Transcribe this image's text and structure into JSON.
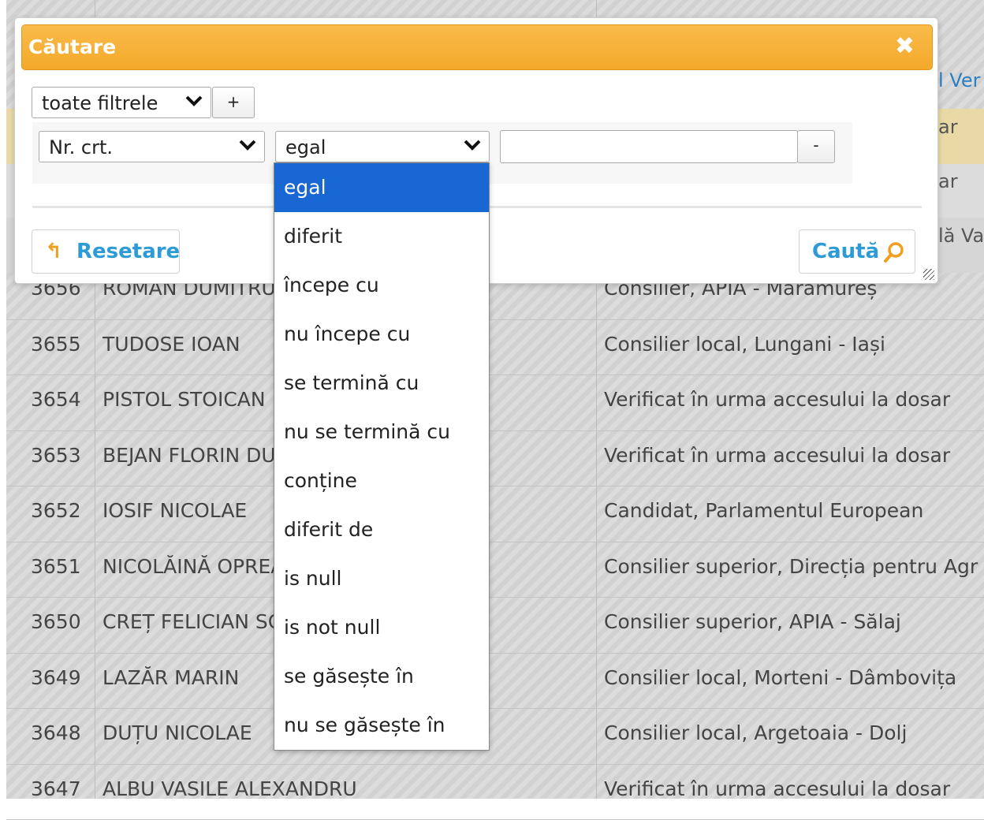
{
  "dialog": {
    "title": "Căutare",
    "close_glyph": "✖",
    "group_filter": {
      "value": "toate filtrele",
      "chevron": "❯"
    },
    "add_button_label": "+",
    "rule": {
      "field_value": "Nr. crt.",
      "operator_value": "egal",
      "value_input": "",
      "remove_button_label": "-"
    },
    "reset_button": {
      "label": "Resetare",
      "icon": "↰"
    },
    "search_button": {
      "label": "Caută",
      "icon": "search-icon"
    }
  },
  "operator_dropdown": {
    "selected": "egal",
    "options": [
      "egal",
      "diferit",
      "începe cu",
      "nu începe cu",
      "se termină cu",
      "nu se termină cu",
      "conține",
      "diferit de",
      "is null",
      "is not null",
      "se găsește în",
      "nu se găsește în"
    ]
  },
  "grid": {
    "peek_texts": [
      "l Ver",
      "ar",
      "ar",
      "lă Va"
    ],
    "rows": [
      {
        "nr": "3656",
        "name": "ROMAN DUMITRU",
        "function": "Consilier, APIA - Maramureș"
      },
      {
        "nr": "3655",
        "name": "TUDOSE IOAN",
        "function": "Consilier local, Lungani - Iași"
      },
      {
        "nr": "3654",
        "name": "PISTOL STOICAN",
        "function": "Verificat în urma accesului la dosar"
      },
      {
        "nr": "3653",
        "name": "BEJAN FLORIN DU",
        "function": "Verificat în urma accesului la dosar"
      },
      {
        "nr": "3652",
        "name": "IOSIF NICOLAE",
        "function": "Candidat, Parlamentul European"
      },
      {
        "nr": "3651",
        "name": "NICOLĂINĂ OPREA",
        "function": "Consilier superior, Direcția pentru Agr"
      },
      {
        "nr": "3650",
        "name": "CREȚ FELICIAN SC",
        "function": "Consilier superior, APIA - Sălaj"
      },
      {
        "nr": "3649",
        "name": "LAZĂR MARIN",
        "function": "Consilier local, Morteni - Dâmbovița"
      },
      {
        "nr": "3648",
        "name": "DUȚU NICOLAE",
        "function": "Consilier local, Argetoaia - Dolj"
      },
      {
        "nr": "3647",
        "name": "ALBU VASILE ALEXANDRU",
        "function": "Verificat în urma accesului la dosar"
      }
    ]
  },
  "colors": {
    "header_orange": "#f4a92a",
    "link_blue": "#2d9bd6",
    "selected_blue": "#1967d2"
  }
}
